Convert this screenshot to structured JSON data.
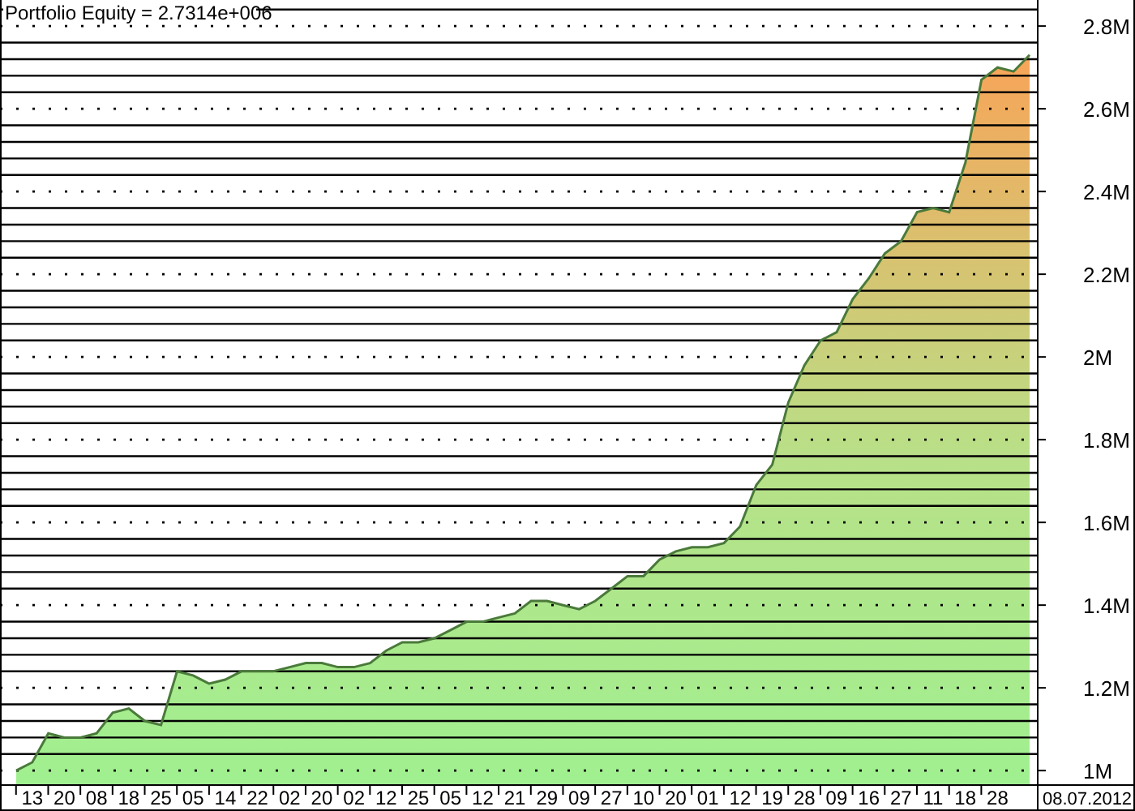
{
  "chart": {
    "end_date": "08.07.2012",
    "chart_data": {
      "type": "area",
      "title": "Portfolio Equity = 2.7314e+006",
      "categories": [
        null,
        "13",
        null,
        "20",
        null,
        "08",
        null,
        "18",
        null,
        "25",
        null,
        "05",
        null,
        "14",
        null,
        "22",
        null,
        "02",
        null,
        "20",
        null,
        "02",
        null,
        "12",
        null,
        "25",
        null,
        "05",
        null,
        "12",
        null,
        "21",
        null,
        "29",
        null,
        "09",
        null,
        "27",
        null,
        "10",
        null,
        "20",
        null,
        "01",
        null,
        "12",
        null,
        "19",
        null,
        "28",
        null,
        "09",
        null,
        "16",
        null,
        "27",
        null,
        "11",
        null,
        "18",
        null,
        "28",
        null,
        null
      ],
      "series": [
        {
          "color": "#4a7a3a",
          "values": [
            1.0,
            1.02,
            1.09,
            1.08,
            1.08,
            1.09,
            1.14,
            1.15,
            1.12,
            1.11,
            1.24,
            1.23,
            1.21,
            1.22,
            1.24,
            1.24,
            1.24,
            1.25,
            1.26,
            1.26,
            1.25,
            1.25,
            1.26,
            1.29,
            1.31,
            1.31,
            1.32,
            1.34,
            1.36,
            1.36,
            1.37,
            1.38,
            1.41,
            1.41,
            1.4,
            1.39,
            1.41,
            1.44,
            1.47,
            1.47,
            1.51,
            1.53,
            1.54,
            1.54,
            1.55,
            1.59,
            1.69,
            1.74,
            1.89,
            1.98,
            2.04,
            2.06,
            2.14,
            2.19,
            2.25,
            2.28,
            2.35,
            2.36,
            2.35,
            2.47,
            2.67,
            2.7,
            2.69,
            2.73
          ]
        }
      ],
      "ylim": [
        0.965,
        2.863
      ],
      "grid": true,
      "yticks": [
        {
          "value": 1,
          "label": "1M"
        },
        {
          "value": 1.2,
          "label": "1.2M"
        },
        {
          "value": 1.4,
          "label": "1.4M"
        },
        {
          "value": 1.6,
          "label": "1.6M"
        },
        {
          "value": 1.8,
          "label": "1.8M"
        },
        {
          "value": 2,
          "label": "2M"
        },
        {
          "value": 2.2,
          "label": "2.2M"
        },
        {
          "value": 2.4,
          "label": "2.4M"
        },
        {
          "value": 2.6,
          "label": "2.6M"
        },
        {
          "value": 2.8,
          "label": "2.8M"
        }
      ]
    }
  }
}
